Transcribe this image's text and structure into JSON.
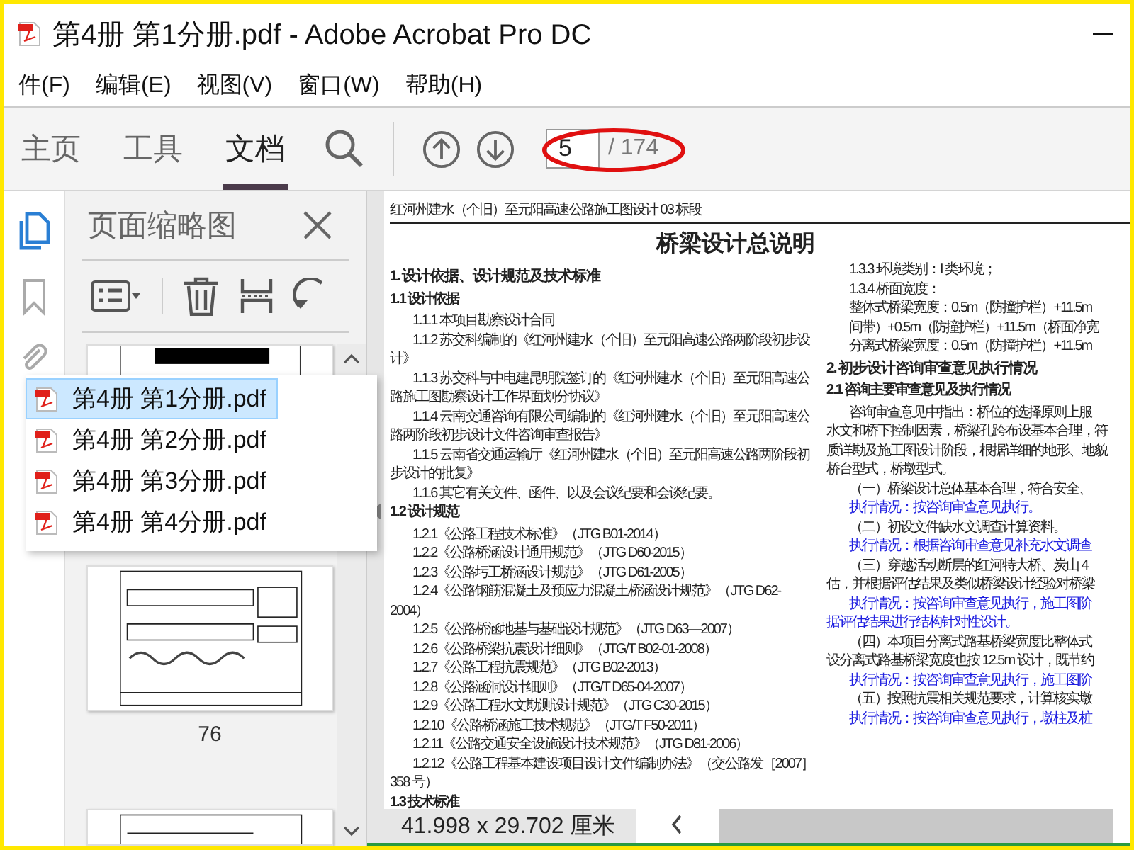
{
  "window": {
    "title": "第4册 第1分册.pdf - Adobe Acrobat Pro DC"
  },
  "menu": [
    "件(F)",
    "编辑(E)",
    "视图(V)",
    "窗口(W)",
    "帮助(H)"
  ],
  "tabs": [
    {
      "label": "主页",
      "selected": false
    },
    {
      "label": "工具",
      "selected": false
    },
    {
      "label": "文档",
      "selected": true
    }
  ],
  "page_nav": {
    "value": "5",
    "total": "/ 174"
  },
  "side_rail": [
    {
      "kind": "pages",
      "selected": true
    },
    {
      "kind": "bookmarks",
      "selected": false
    },
    {
      "kind": "attachments",
      "selected": false
    }
  ],
  "thumbnail_panel": {
    "title": "页面缩略图",
    "page_label": "76"
  },
  "file_menu": [
    {
      "label": "第4册 第1分册.pdf",
      "selected": true
    },
    {
      "label": "第4册 第2分册.pdf",
      "selected": false
    },
    {
      "label": "第4册 第3分册.pdf",
      "selected": false
    },
    {
      "label": "第4册 第4分册.pdf",
      "selected": false
    }
  ],
  "document": {
    "header": "红河州建水（个旧）至元阳高速公路施工图设计 03 标段",
    "title": "桥梁设计总说明",
    "left_column": [
      {
        "kind": "h1",
        "text": "1. 设计依据、设计规范及技术标准"
      },
      {
        "kind": "h2",
        "text": "1.1 设计依据"
      },
      {
        "kind": "item",
        "text": "1.1.1 本项目勘察设计合同"
      },
      {
        "kind": "item",
        "text": "1.1.2 苏交科编制的《红河州建水（个旧）至元阳高速公路两阶段初步设计》"
      },
      {
        "kind": "item",
        "text": "1.1.3 苏交科与中电建昆明院签订的《红河州建水（个旧）至元阳高速公路施工图勘察设计工作界面划分协议》"
      },
      {
        "kind": "item",
        "text": "1.1.4 云南交通咨询有限公司编制的《红河州建水（个旧）至元阳高速公路两阶段初步设计文件咨询审查报告》"
      },
      {
        "kind": "item",
        "text": "1.1.5 云南省交通运输厅《红河州建水（个旧）至元阳高速公路两阶段初步设计的批复》"
      },
      {
        "kind": "item",
        "text": "1.1.6 其它有关文件、函件、以及会议纪要和会谈纪要。"
      },
      {
        "kind": "h2",
        "text": "1.2 设计规范"
      },
      {
        "kind": "item",
        "text": "1.2.1《公路工程技术标准》（JTG B01-2014）"
      },
      {
        "kind": "item",
        "text": "1.2.2《公路桥涵设计通用规范》（JTG D60-2015）"
      },
      {
        "kind": "item",
        "text": "1.2.3《公路圬工桥涵设计规范》（JTG D61-2005）"
      },
      {
        "kind": "item",
        "text": "1.2.4《公路钢筋混凝土及预应力混凝土桥涵设计规范》（JTG D62-2004）"
      },
      {
        "kind": "item",
        "text": "1.2.5《公路桥涵地基与基础设计规范》（JTG D63—2007）"
      },
      {
        "kind": "item",
        "text": "1.2.6《公路桥梁抗震设计细则》（JTG/T B02-01-2008）"
      },
      {
        "kind": "item",
        "text": "1.2.7《公路工程抗震规范》（JTG B02-2013）"
      },
      {
        "kind": "item",
        "text": "1.2.8《公路涵洞设计细则》（JTG/T D65-04-2007）"
      },
      {
        "kind": "item",
        "text": "1.2.9《公路工程水文勘测设计规范》（JTG C30-2015）"
      },
      {
        "kind": "item",
        "text": "1.2.10《公路桥涵施工技术规范》（JTG/T F50-2011）"
      },
      {
        "kind": "item",
        "text": "1.2.11《公路交通安全设施设计技术规范》（JTG D81-2006）"
      },
      {
        "kind": "item",
        "text": "1.2.12《公路工程基本建设项目设计文件编制办法》（交公路发［2007］358 号）"
      },
      {
        "kind": "h2",
        "text": "1.3 技术标准"
      }
    ],
    "right_column": [
      {
        "kind": "item",
        "text": "1.3.3 环境类别：I 类环境；"
      },
      {
        "kind": "item",
        "text": "1.3.4 桥面宽度："
      },
      {
        "kind": "item",
        "text": "整体式桥梁宽度：0.5m（防撞护栏）+11.5m"
      },
      {
        "kind": "item",
        "text": "间带）+0.5m（防撞护栏）+11.5m（桥面净宽"
      },
      {
        "kind": "item",
        "text": "分离式桥梁宽度：0.5m（防撞护栏）+11.5m"
      },
      {
        "kind": "h1",
        "text": "2. 初步设计咨询审查意见执行情况"
      },
      {
        "kind": "h2",
        "text": "2.1 咨询主要审查意见及执行情况"
      },
      {
        "kind": "item",
        "text": "咨询审查意见中指出：桥位的选择原则上服"
      },
      {
        "kind": "text",
        "text": "水文和桥下控制因素，桥梁孔跨布设基本合理，符"
      },
      {
        "kind": "text",
        "text": "质详勘及施工图设计阶段，根据详细的地形、地貌"
      },
      {
        "kind": "text",
        "text": "桥台型式，桥墩型式。"
      },
      {
        "kind": "item",
        "text": "（一）桥梁设计总体基本合理，符合安全、"
      },
      {
        "kind": "note",
        "text": "执行情况：按咨询审查意见执行。"
      },
      {
        "kind": "item",
        "text": "（二）初设文件缺水文调查计算资料。"
      },
      {
        "kind": "note",
        "text": "执行情况：根据咨询审查意见补充水文调查"
      },
      {
        "kind": "item",
        "text": "（三）穿越活动断层的红河特大桥、炭山 4"
      },
      {
        "kind": "text",
        "text": "估，并根据评估结果及类似桥梁设计经验对桥梁"
      },
      {
        "kind": "note",
        "text": "执行情况：按咨询审查意见执行，施工图阶"
      },
      {
        "kind": "note-text",
        "text": "据评估结果进行结构针对性设计。"
      },
      {
        "kind": "item",
        "text": "（四）本项目分离式路基桥梁宽度比整体式"
      },
      {
        "kind": "text",
        "text": "设分离式路基桥梁宽度也按 12.5m 设计，既节约"
      },
      {
        "kind": "note",
        "text": "执行情况：按咨询审查意见执行，施工图阶"
      },
      {
        "kind": "item",
        "text": "（五）按照抗震相关规范要求，计算核实墩"
      },
      {
        "kind": "note",
        "text": "执行情况：按咨询审查意见执行，墩柱及桩"
      }
    ]
  },
  "status_bar": {
    "page_size": "41.998 x 29.702 厘米"
  }
}
